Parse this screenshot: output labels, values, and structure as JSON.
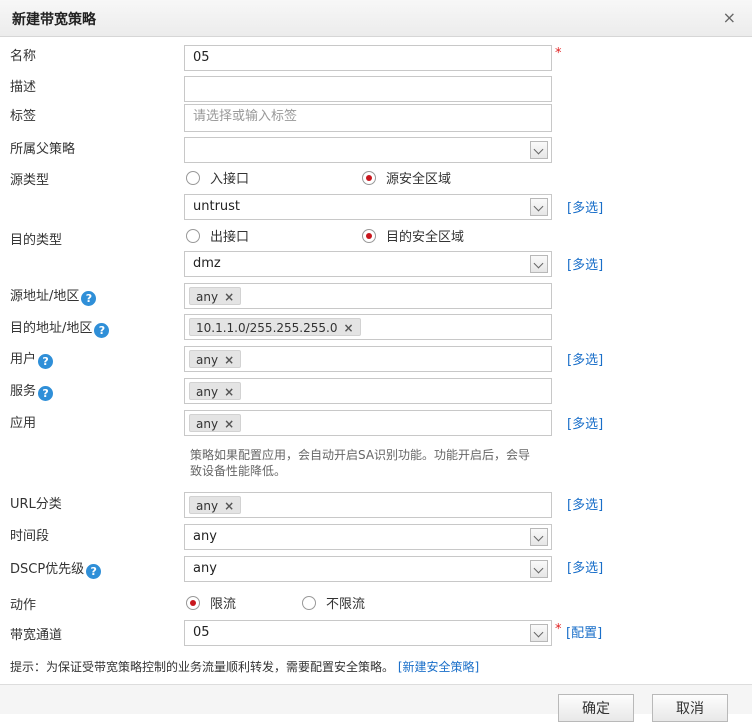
{
  "dialog": {
    "title": "新建带宽策略",
    "close": "×"
  },
  "labels": {
    "name": "名称",
    "desc": "描述",
    "tag": "标签",
    "parent": "所属父策略",
    "src_type": "源类型",
    "dst_type": "目的类型",
    "src_addr": "源地址/地区",
    "dst_addr": "目的地址/地区",
    "user": "用户",
    "service": "服务",
    "app": "应用",
    "url": "URL分类",
    "time": "时间段",
    "dscp": "DSCP优先级",
    "action": "动作",
    "channel": "带宽通道"
  },
  "help_icon": "?",
  "fields": {
    "name_value": "05",
    "desc_value": "",
    "tag_placeholder": "请选择或输入标签",
    "parent_value": "",
    "src_zone": "untrust",
    "dst_zone": "dmz",
    "src_addr_tag": "any",
    "dst_addr_tag": "10.1.1.0/255.255.255.0",
    "user_tag": "any",
    "service_tag": "any",
    "app_tag": "any",
    "url_tag": "any",
    "time_value": "any",
    "dscp_value": "any",
    "channel_value": "05"
  },
  "tag_remove": "×",
  "required_mark": "*",
  "radios": {
    "src_interface": "入接口",
    "src_zone": "源安全区域",
    "dst_interface": "出接口",
    "dst_zone": "目的安全区域",
    "limit": "限流",
    "no_limit": "不限流"
  },
  "selected": {
    "src_type": "源安全区域",
    "dst_type": "目的安全区域",
    "action": "限流"
  },
  "links": {
    "multi": "[多选]",
    "config": "[配置]"
  },
  "app_hint": "策略如果配置应用，会自动开启SA识别功能。功能开启后，会导致设备性能降低。",
  "tip": {
    "text": "提示：为保证受带宽策略控制的业务流量顺利转发，需要配置安全策略。",
    "link": "[新建安全策略]"
  },
  "buttons": {
    "ok": "确定",
    "cancel": "取消"
  },
  "colors": {
    "link": "#1a6fc9",
    "required": "#e02020",
    "radio_on": "#c8171e",
    "help": "#2f8fd8"
  }
}
